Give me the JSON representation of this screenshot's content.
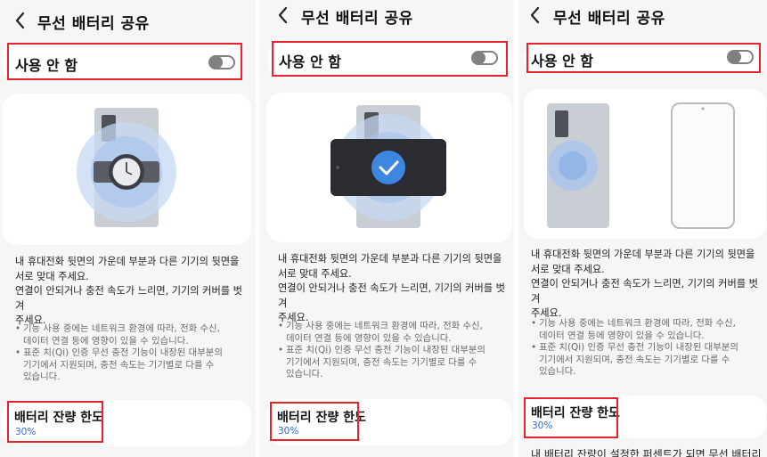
{
  "screen": {
    "title": "무선 배터리 공유",
    "toggle_label": "사용 안 함",
    "toggle_on": false,
    "description": [
      "내 휴대전화 뒷면의 가운데 부분과 다른 기기의 뒷면을",
      "서로 맞대 주세요.",
      "연결이 안되거나 충전 속도가 느리면, 기기의 커버를 벗겨",
      "주세요."
    ],
    "notes": [
      {
        "bullet": "•",
        "lines": [
          "기능 사용 중에는 네트워크 환경에 따라, 전화 수신,",
          "데이터 연결 등에 영향이 있을 수 있습니다."
        ]
      },
      {
        "bullet": "•",
        "lines": [
          "표준 치(Qi) 인증 무선 충전 기능이 내장된 대부분의",
          "기기에서 지원되며, 충전 속도는 기기별로 다를 수",
          "있습니다."
        ]
      }
    ],
    "battery_limit": {
      "title": "배터리 잔량 한도",
      "value": "30%"
    },
    "cut_text": "내 배터리 잔량이 설정한 퍼센트가 되면 무선 배터리"
  },
  "panels": [
    {
      "illustration": "watch-on-phone"
    },
    {
      "illustration": "phone-on-phone-check"
    },
    {
      "illustration": "phone-and-phone-side-by-side"
    }
  ],
  "colors": {
    "panel_bg": "#f6f6f6",
    "card_bg": "#ffffff",
    "highlight_red": "#e8232b",
    "accent_blue": "#2d6bd6",
    "toggle_gray": "#808080"
  }
}
